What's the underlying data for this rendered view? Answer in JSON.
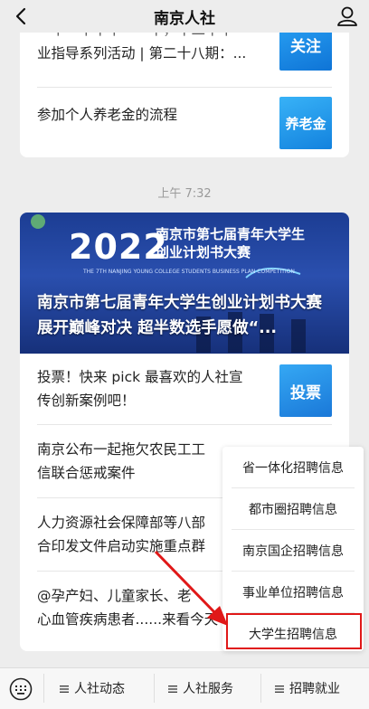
{
  "header": {
    "title": "南京人社"
  },
  "card1": {
    "articles": [
      {
        "title_line1": "一十一十十十一一十，十二十十一",
        "title_line2": "业指导系列活动 | 第二十八期：...",
        "thumb": "关注"
      },
      {
        "title_line1": "参加个人养老金的流程",
        "title_line2": "",
        "thumb": "养老金"
      }
    ]
  },
  "timestamp": "上午 7:32",
  "card2": {
    "banner": {
      "year": "2022",
      "event_line1": "南京市第七届青年大学生",
      "event_line2": "创业计划书大赛",
      "subtitle_en": "THE 7TH NANJING YOUNG COLLEGE STUDENTS BUSINESS PLAN COMPETITION",
      "headline": "南京市第七届青年大学生创业计划书大赛展开巅峰对决 超半数选手愿做“..."
    },
    "articles": [
      {
        "title_line1": "投票！快来 pick 最喜欢的人社宣",
        "title_line2": "传创新案例吧！",
        "thumb": "投票"
      },
      {
        "title_line1": "南京公布一起拖欠农民工工",
        "title_line2": "信联合惩戒案件",
        "thumb": ""
      },
      {
        "title_line1": "人力资源社会保障部等八部",
        "title_line2": "合印发文件启动实施重点群",
        "thumb": ""
      },
      {
        "title_line1": "@孕产妇、儿童家长、老",
        "title_line2": "心血管疾病患者......来看今天",
        "thumb": ""
      }
    ]
  },
  "menu_popup": {
    "items": [
      "省一体化招聘信息",
      "都市圈招聘信息",
      "南京国企招聘信息",
      "事业单位招聘信息",
      "大学生招聘信息"
    ]
  },
  "bottom_bar": {
    "tabs": [
      "人社动态",
      "人社服务",
      "招聘就业"
    ]
  },
  "colors": {
    "highlight": "#e01818",
    "thumb_blue": "#1e8fe8"
  }
}
